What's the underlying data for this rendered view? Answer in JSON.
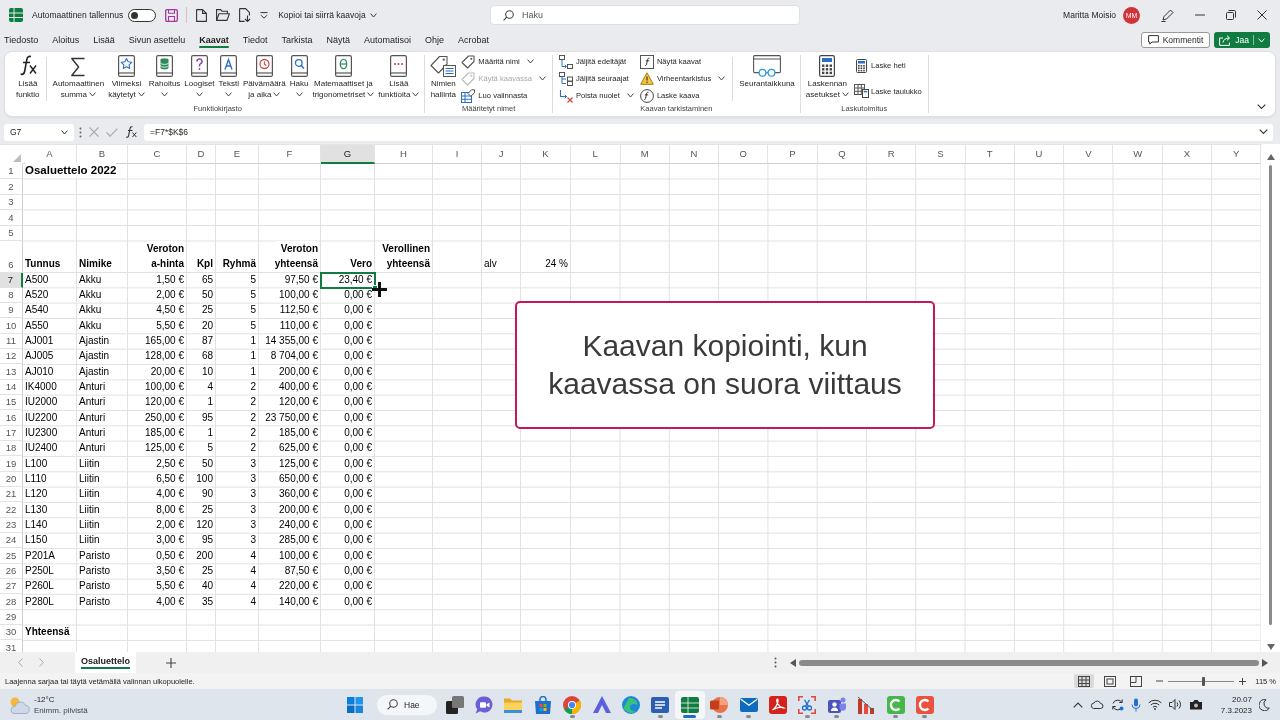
{
  "title_bar": {
    "autosave_label": "Automaattinen tallennus",
    "autosave_on": false,
    "document_title": "Kopioi tai siirrä kaavoja",
    "search_placeholder": "Haku",
    "user_name": "Maritta Moisio",
    "user_initials": "MM"
  },
  "menu_tabs": [
    {
      "label": "Tiedosto",
      "selected": false
    },
    {
      "label": "Aloitus",
      "selected": false
    },
    {
      "label": "Lisää",
      "selected": false
    },
    {
      "label": "Sivun asettelu",
      "selected": false
    },
    {
      "label": "Kaavat",
      "selected": true
    },
    {
      "label": "Tiedot",
      "selected": false
    },
    {
      "label": "Tarkista",
      "selected": false
    },
    {
      "label": "Näytä",
      "selected": false
    },
    {
      "label": "Automatisoi",
      "selected": false
    },
    {
      "label": "Ohje",
      "selected": false
    },
    {
      "label": "Acrobat",
      "selected": false
    }
  ],
  "header_actions": {
    "comments": "Kommentit",
    "share": "Jaa"
  },
  "ribbon": {
    "groups": [
      {
        "label": "Funktiokirjasto",
        "sections": [
          [
            {
              "kind": "large",
              "lines": [
                "Lisää",
                "funktio"
              ],
              "dropdown": false,
              "disabled": false
            }
          ],
          [
            {
              "kind": "large",
              "lines": [
                "Automaattinen",
                "summa"
              ],
              "dropdown": true,
              "disabled": false
            },
            {
              "kind": "large",
              "lines": [
                "Viimeksi",
                "käytetyt"
              ],
              "dropdown": true,
              "disabled": false
            },
            {
              "kind": "large",
              "lines": [
                "Rahoitus"
              ],
              "dropdown": true,
              "disabled": false
            },
            {
              "kind": "large",
              "lines": [
                "Loogiset"
              ],
              "dropdown": true,
              "disabled": false
            },
            {
              "kind": "large",
              "lines": [
                "Teksti"
              ],
              "dropdown": true,
              "disabled": false
            },
            {
              "kind": "large",
              "lines": [
                "Päivämäärä",
                "ja aika"
              ],
              "dropdown": true,
              "disabled": false
            },
            {
              "kind": "large",
              "lines": [
                "Haku"
              ],
              "dropdown": true,
              "disabled": false
            },
            {
              "kind": "large",
              "lines": [
                "Matemaattiset ja",
                "trigonometriset"
              ],
              "dropdown": true,
              "disabled": false
            },
            {
              "kind": "large",
              "lines": [
                "Lisää",
                "funktioita"
              ],
              "dropdown": true,
              "disabled": false
            }
          ]
        ]
      },
      {
        "label": "Määritetyt nimet",
        "sections": [
          [
            {
              "kind": "large",
              "lines": [
                "Nimien",
                "hallinta"
              ],
              "dropdown": false,
              "disabled": false
            },
            {
              "kind": "stack",
              "items": [
                {
                  "label": "Määritä nimi",
                  "dropdown": true,
                  "disabled": false
                },
                {
                  "label": "Käytä kaavassa",
                  "dropdown": true,
                  "disabled": true
                },
                {
                  "label": "Luo valinnasta",
                  "dropdown": false,
                  "disabled": false
                }
              ]
            }
          ]
        ]
      },
      {
        "label": "Kaavan tarkistaminen",
        "sections": [
          [
            {
              "kind": "stack",
              "items": [
                {
                  "label": "Jäljitä edeltäjät",
                  "dropdown": false,
                  "disabled": false
                },
                {
                  "label": "Jäljitä seuraajat",
                  "dropdown": false,
                  "disabled": false
                },
                {
                  "label": "Poista nuolet",
                  "dropdown": true,
                  "disabled": false
                }
              ]
            },
            {
              "kind": "stack",
              "items": [
                {
                  "label": "Näytä kaavat",
                  "dropdown": false,
                  "disabled": false
                },
                {
                  "label": "Virheentarkistus",
                  "dropdown": true,
                  "disabled": false
                },
                {
                  "label": "Laske kaava",
                  "dropdown": false,
                  "disabled": false
                }
              ]
            }
          ],
          [
            {
              "kind": "large",
              "lines": [
                "Seurantaikkuna"
              ],
              "dropdown": false,
              "disabled": false
            }
          ]
        ]
      },
      {
        "label": "Laskutoimitus",
        "sections": [
          [
            {
              "kind": "large",
              "lines": [
                "Laskennan",
                "asetukset"
              ],
              "dropdown": true,
              "disabled": false
            },
            {
              "kind": "stack",
              "items": [
                {
                  "label": "Laske heti",
                  "dropdown": false,
                  "disabled": false
                },
                {
                  "label": "Laske taulukko",
                  "dropdown": false,
                  "disabled": false
                }
              ]
            }
          ]
        ]
      }
    ]
  },
  "formula_bar": {
    "name_box": "G7",
    "formula": "=F7*$K$6"
  },
  "sheet": {
    "columns": [
      {
        "label": "A",
        "selected": false
      },
      {
        "label": "B",
        "selected": false
      },
      {
        "label": "C",
        "selected": false
      },
      {
        "label": "D",
        "selected": false
      },
      {
        "label": "E",
        "selected": false
      },
      {
        "label": "F",
        "selected": false
      },
      {
        "label": "G",
        "selected": true
      },
      {
        "label": "H",
        "selected": false
      },
      {
        "label": "I",
        "selected": false
      },
      {
        "label": "J",
        "selected": false
      },
      {
        "label": "K",
        "selected": false
      },
      {
        "label": "L",
        "selected": false
      },
      {
        "label": "M",
        "selected": false
      },
      {
        "label": "N",
        "selected": false
      },
      {
        "label": "O",
        "selected": false
      },
      {
        "label": "P",
        "selected": false
      },
      {
        "label": "Q",
        "selected": false
      },
      {
        "label": "R",
        "selected": false
      },
      {
        "label": "S",
        "selected": false
      },
      {
        "label": "T",
        "selected": false
      },
      {
        "label": "U",
        "selected": false
      },
      {
        "label": "V",
        "selected": false
      },
      {
        "label": "W",
        "selected": false
      },
      {
        "label": "X",
        "selected": false
      },
      {
        "label": "Y",
        "selected": false
      }
    ],
    "rows": [
      {
        "label": "1",
        "selected": false,
        "kind": "title",
        "cells": [
          "Osaluettelo 2022"
        ]
      },
      {
        "label": "2",
        "selected": false,
        "kind": "blank"
      },
      {
        "label": "3",
        "selected": false,
        "kind": "blank"
      },
      {
        "label": "4",
        "selected": false,
        "kind": "blank"
      },
      {
        "label": "5",
        "selected": false,
        "kind": "blank"
      },
      {
        "label": "6",
        "selected": false,
        "kind": "header",
        "cells": [
          "Tunnus",
          "Nimike",
          "Veroton\na-hinta",
          "Kpl",
          "Ryhmä",
          "Veroton\nyhteensä",
          "Vero",
          "Verollinen\nyhteensä",
          null,
          "alv",
          "24 %"
        ]
      },
      {
        "label": "7",
        "selected": true,
        "kind": "data",
        "cells": [
          "A500",
          "Akku",
          "1,50 €",
          "65",
          "5",
          "97,50 €",
          "23,40 €"
        ]
      },
      {
        "label": "8",
        "selected": false,
        "kind": "data",
        "cells": [
          "A520",
          "Akku",
          "2,00 €",
          "50",
          "5",
          "100,00 €",
          "0,00 €"
        ]
      },
      {
        "label": "9",
        "selected": false,
        "kind": "data",
        "cells": [
          "A540",
          "Akku",
          "4,50 €",
          "25",
          "5",
          "112,50 €",
          "0,00 €"
        ]
      },
      {
        "label": "10",
        "selected": false,
        "kind": "data",
        "cells": [
          "A550",
          "Akku",
          "5,50 €",
          "20",
          "5",
          "110,00 €",
          "0,00 €"
        ]
      },
      {
        "label": "11",
        "selected": false,
        "kind": "data",
        "cells": [
          "AJ001",
          "Ajastin",
          "165,00 €",
          "87",
          "1",
          "14 355,00 €",
          "0,00 €"
        ]
      },
      {
        "label": "12",
        "selected": false,
        "kind": "data",
        "cells": [
          "AJ005",
          "Ajastin",
          "128,00 €",
          "68",
          "1",
          "8 704,00 €",
          "0,00 €"
        ]
      },
      {
        "label": "13",
        "selected": false,
        "kind": "data",
        "cells": [
          "AJ010",
          "Ajastin",
          "20,00 €",
          "10",
          "1",
          "200,00 €",
          "0,00 €"
        ]
      },
      {
        "label": "14",
        "selected": false,
        "kind": "data",
        "cells": [
          "IK4000",
          "Anturi",
          "100,00 €",
          "4",
          "2",
          "400,00 €",
          "0,00 €"
        ]
      },
      {
        "label": "15",
        "selected": false,
        "kind": "data",
        "cells": [
          "IU2000",
          "Anturi",
          "120,00 €",
          "1",
          "2",
          "120,00 €",
          "0,00 €"
        ]
      },
      {
        "label": "16",
        "selected": false,
        "kind": "data",
        "cells": [
          "IU2200",
          "Anturi",
          "250,00 €",
          "95",
          "2",
          "23 750,00 €",
          "0,00 €"
        ]
      },
      {
        "label": "17",
        "selected": false,
        "kind": "data",
        "cells": [
          "IU2300",
          "Anturi",
          "185,00 €",
          "1",
          "2",
          "185,00 €",
          "0,00 €"
        ]
      },
      {
        "label": "18",
        "selected": false,
        "kind": "data",
        "cells": [
          "IU2400",
          "Anturi",
          "125,00 €",
          "5",
          "2",
          "625,00 €",
          "0,00 €"
        ]
      },
      {
        "label": "19",
        "selected": false,
        "kind": "data",
        "cells": [
          "L100",
          "Liitin",
          "2,50 €",
          "50",
          "3",
          "125,00 €",
          "0,00 €"
        ]
      },
      {
        "label": "20",
        "selected": false,
        "kind": "data",
        "cells": [
          "L110",
          "Liitin",
          "6,50 €",
          "100",
          "3",
          "650,00 €",
          "0,00 €"
        ]
      },
      {
        "label": "21",
        "selected": false,
        "kind": "data",
        "cells": [
          "L120",
          "Liitin",
          "4,00 €",
          "90",
          "3",
          "360,00 €",
          "0,00 €"
        ]
      },
      {
        "label": "22",
        "selected": false,
        "kind": "data",
        "cells": [
          "L130",
          "Liitin",
          "8,00 €",
          "25",
          "3",
          "200,00 €",
          "0,00 €"
        ]
      },
      {
        "label": "23",
        "selected": false,
        "kind": "data",
        "cells": [
          "L140",
          "Liitin",
          "2,00 €",
          "120",
          "3",
          "240,00 €",
          "0,00 €"
        ]
      },
      {
        "label": "24",
        "selected": false,
        "kind": "data",
        "cells": [
          "L150",
          "Liitin",
          "3,00 €",
          "95",
          "3",
          "285,00 €",
          "0,00 €"
        ]
      },
      {
        "label": "25",
        "selected": false,
        "kind": "data",
        "cells": [
          "P201A",
          "Paristo",
          "0,50 €",
          "200",
          "4",
          "100,00 €",
          "0,00 €"
        ]
      },
      {
        "label": "26",
        "selected": false,
        "kind": "data",
        "cells": [
          "P250L",
          "Paristo",
          "3,50 €",
          "25",
          "4",
          "87,50 €",
          "0,00 €"
        ]
      },
      {
        "label": "27",
        "selected": false,
        "kind": "data",
        "cells": [
          "P260L",
          "Paristo",
          "5,50 €",
          "40",
          "4",
          "220,00 €",
          "0,00 €"
        ]
      },
      {
        "label": "28",
        "selected": false,
        "kind": "data",
        "cells": [
          "P280L",
          "Paristo",
          "4,00 €",
          "35",
          "4",
          "140,00 €",
          "0,00 €"
        ]
      },
      {
        "label": "29",
        "selected": false,
        "kind": "blank"
      },
      {
        "label": "30",
        "selected": false,
        "kind": "total",
        "cells": [
          "Yhteensä"
        ]
      },
      {
        "label": "31",
        "selected": false,
        "kind": "blank"
      }
    ]
  },
  "callout": {
    "text": "Kaavan kopiointi, kun kaavassa on suora viittaus"
  },
  "sheet_tabs": [
    {
      "label": "Osaluettelo",
      "selected": true
    }
  ],
  "status_bar": {
    "message": "Laajenna sarjaa tai täytä vetämällä valinnan ulkopuolelle.",
    "views": [
      {
        "selected": true
      },
      {
        "selected": false
      },
      {
        "selected": false
      }
    ],
    "zoom_slider": {
      "level": 0.53
    },
    "zoom_text": "115 %"
  },
  "taskbar": {
    "weather": {
      "temperature": "-12°C",
      "condition": "Enimm. pilvistä"
    },
    "search_label": "Hae",
    "apps": [
      {
        "running": false,
        "selected": false
      },
      {
        "running": false,
        "selected": false
      },
      {
        "running": false,
        "selected": false
      },
      {
        "running": false,
        "selected": false
      },
      {
        "running": true,
        "selected": false
      },
      {
        "running": false,
        "selected": false
      },
      {
        "running": false,
        "selected": false
      },
      {
        "running": true,
        "selected": false
      },
      {
        "running": true,
        "selected": true
      },
      {
        "running": true,
        "selected": false
      },
      {
        "running": true,
        "selected": false
      },
      {
        "running": false,
        "selected": false
      },
      {
        "running": true,
        "selected": false
      },
      {
        "running": true,
        "selected": false
      },
      {
        "running": false,
        "selected": false
      },
      {
        "running": true,
        "selected": false
      },
      {
        "running": true,
        "selected": false
      }
    ],
    "clock": {
      "time": "20.07",
      "date": "7.3.2023"
    }
  }
}
